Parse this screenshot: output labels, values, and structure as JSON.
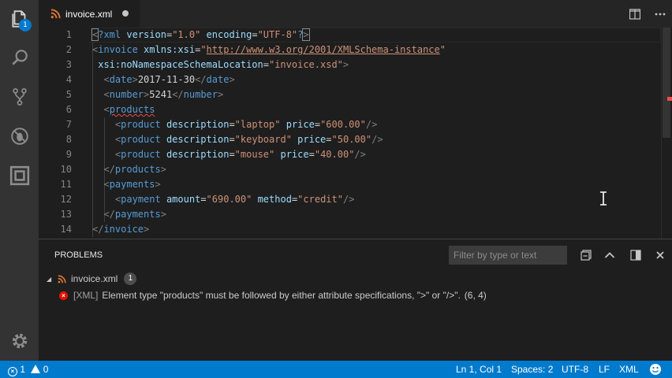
{
  "activity": {
    "explorer_badge": "1"
  },
  "tab": {
    "filename": "invoice.xml"
  },
  "editor": {
    "line_numbers": [
      "1",
      "2",
      "3",
      "4",
      "5",
      "6",
      "7",
      "8",
      "9",
      "10",
      "11",
      "12",
      "13",
      "14"
    ],
    "lines": [
      {
        "tokens": [
          {
            "c": "br",
            "t": "<"
          },
          {
            "c": "tg",
            "t": "?xml"
          },
          {
            "c": "tx",
            "t": " "
          },
          {
            "c": "at",
            "t": "version"
          },
          {
            "c": "tx",
            "t": "="
          },
          {
            "c": "st",
            "t": "\"1.0\""
          },
          {
            "c": "tx",
            "t": " "
          },
          {
            "c": "at",
            "t": "encoding"
          },
          {
            "c": "tx",
            "t": "="
          },
          {
            "c": "st",
            "t": "\"UTF-8\""
          },
          {
            "c": "tg",
            "t": "?"
          },
          {
            "c": "br",
            "t": ">"
          }
        ]
      },
      {
        "tokens": [
          {
            "c": "br",
            "t": "<"
          },
          {
            "c": "tg",
            "t": "invoice"
          },
          {
            "c": "tx",
            "t": " "
          },
          {
            "c": "at",
            "t": "xmlns:xsi"
          },
          {
            "c": "tx",
            "t": "="
          },
          {
            "c": "st",
            "t": "\""
          },
          {
            "c": "st ul",
            "t": "http://www.w3.org/2001/XMLSchema-instance"
          },
          {
            "c": "st",
            "t": "\""
          }
        ]
      },
      {
        "tokens": [
          {
            "c": "tx",
            "t": " "
          },
          {
            "c": "at",
            "t": "xsi:noNamespaceSchemaLocation"
          },
          {
            "c": "tx",
            "t": "="
          },
          {
            "c": "st",
            "t": "\"invoice.xsd\""
          },
          {
            "c": "br",
            "t": ">"
          }
        ]
      },
      {
        "tokens": [
          {
            "c": "tx",
            "t": "  "
          },
          {
            "c": "br",
            "t": "<"
          },
          {
            "c": "tg",
            "t": "date"
          },
          {
            "c": "br",
            "t": ">"
          },
          {
            "c": "tx",
            "t": "2017-11-30"
          },
          {
            "c": "br",
            "t": "</"
          },
          {
            "c": "tg",
            "t": "date"
          },
          {
            "c": "br",
            "t": ">"
          }
        ]
      },
      {
        "tokens": [
          {
            "c": "tx",
            "t": "  "
          },
          {
            "c": "br",
            "t": "<"
          },
          {
            "c": "tg",
            "t": "number"
          },
          {
            "c": "br",
            "t": ">"
          },
          {
            "c": "tx",
            "t": "5241"
          },
          {
            "c": "br",
            "t": "</"
          },
          {
            "c": "tg",
            "t": "number"
          },
          {
            "c": "br",
            "t": ">"
          }
        ]
      },
      {
        "tokens": [
          {
            "c": "tx",
            "t": "  "
          },
          {
            "c": "br",
            "t": "<"
          },
          {
            "c": "tg squig",
            "t": "products"
          }
        ]
      },
      {
        "tokens": [
          {
            "c": "tx",
            "t": "    "
          },
          {
            "c": "br",
            "t": "<"
          },
          {
            "c": "tg",
            "t": "product"
          },
          {
            "c": "tx",
            "t": " "
          },
          {
            "c": "at",
            "t": "description"
          },
          {
            "c": "tx",
            "t": "="
          },
          {
            "c": "st",
            "t": "\"laptop\""
          },
          {
            "c": "tx",
            "t": " "
          },
          {
            "c": "at",
            "t": "price"
          },
          {
            "c": "tx",
            "t": "="
          },
          {
            "c": "st",
            "t": "\"600.00\""
          },
          {
            "c": "br",
            "t": "/>"
          }
        ]
      },
      {
        "tokens": [
          {
            "c": "tx",
            "t": "    "
          },
          {
            "c": "br",
            "t": "<"
          },
          {
            "c": "tg",
            "t": "product"
          },
          {
            "c": "tx",
            "t": " "
          },
          {
            "c": "at",
            "t": "description"
          },
          {
            "c": "tx",
            "t": "="
          },
          {
            "c": "st",
            "t": "\"keyboard\""
          },
          {
            "c": "tx",
            "t": " "
          },
          {
            "c": "at",
            "t": "price"
          },
          {
            "c": "tx",
            "t": "="
          },
          {
            "c": "st",
            "t": "\"50.00\""
          },
          {
            "c": "br",
            "t": "/>"
          }
        ]
      },
      {
        "tokens": [
          {
            "c": "tx",
            "t": "    "
          },
          {
            "c": "br",
            "t": "<"
          },
          {
            "c": "tg",
            "t": "product"
          },
          {
            "c": "tx",
            "t": " "
          },
          {
            "c": "at",
            "t": "description"
          },
          {
            "c": "tx",
            "t": "="
          },
          {
            "c": "st",
            "t": "\"mouse\""
          },
          {
            "c": "tx",
            "t": " "
          },
          {
            "c": "at",
            "t": "price"
          },
          {
            "c": "tx",
            "t": "="
          },
          {
            "c": "st",
            "t": "\"40.00\""
          },
          {
            "c": "br",
            "t": "/>"
          }
        ]
      },
      {
        "tokens": [
          {
            "c": "tx",
            "t": "  "
          },
          {
            "c": "br",
            "t": "</"
          },
          {
            "c": "tg",
            "t": "products"
          },
          {
            "c": "br",
            "t": ">"
          }
        ]
      },
      {
        "tokens": [
          {
            "c": "tx",
            "t": "  "
          },
          {
            "c": "br",
            "t": "<"
          },
          {
            "c": "tg",
            "t": "payments"
          },
          {
            "c": "br",
            "t": ">"
          }
        ]
      },
      {
        "tokens": [
          {
            "c": "tx",
            "t": "    "
          },
          {
            "c": "br",
            "t": "<"
          },
          {
            "c": "tg",
            "t": "payment"
          },
          {
            "c": "tx",
            "t": " "
          },
          {
            "c": "at",
            "t": "amount"
          },
          {
            "c": "tx",
            "t": "="
          },
          {
            "c": "st",
            "t": "\"690.00\""
          },
          {
            "c": "tx",
            "t": " "
          },
          {
            "c": "at",
            "t": "method"
          },
          {
            "c": "tx",
            "t": "="
          },
          {
            "c": "st",
            "t": "\"credit\""
          },
          {
            "c": "br",
            "t": "/>"
          }
        ]
      },
      {
        "tokens": [
          {
            "c": "tx",
            "t": "  "
          },
          {
            "c": "br",
            "t": "</"
          },
          {
            "c": "tg",
            "t": "payments"
          },
          {
            "c": "br",
            "t": ">"
          }
        ]
      },
      {
        "tokens": [
          {
            "c": "br",
            "t": "</"
          },
          {
            "c": "tg",
            "t": "invoice"
          },
          {
            "c": "br",
            "t": ">"
          }
        ]
      }
    ]
  },
  "panel": {
    "title": "PROBLEMS",
    "filter_placeholder": "Filter by type or text",
    "file": "invoice.xml",
    "file_count": "1",
    "problem_source": "[XML]",
    "problem_message": "Element type \"products\" must be followed by either attribute specifications, \">\" or \"/>\".",
    "problem_location": "(6, 4)"
  },
  "status": {
    "errors": "1",
    "warnings": "0",
    "position": "Ln 1, Col 1",
    "spaces": "Spaces: 2",
    "encoding": "UTF-8",
    "eol": "LF",
    "language": "XML"
  },
  "colors": {
    "accent": "#007acc",
    "error": "#e51400",
    "tag": "#569cd6",
    "attribute": "#9cdcfe",
    "string": "#ce9178"
  }
}
